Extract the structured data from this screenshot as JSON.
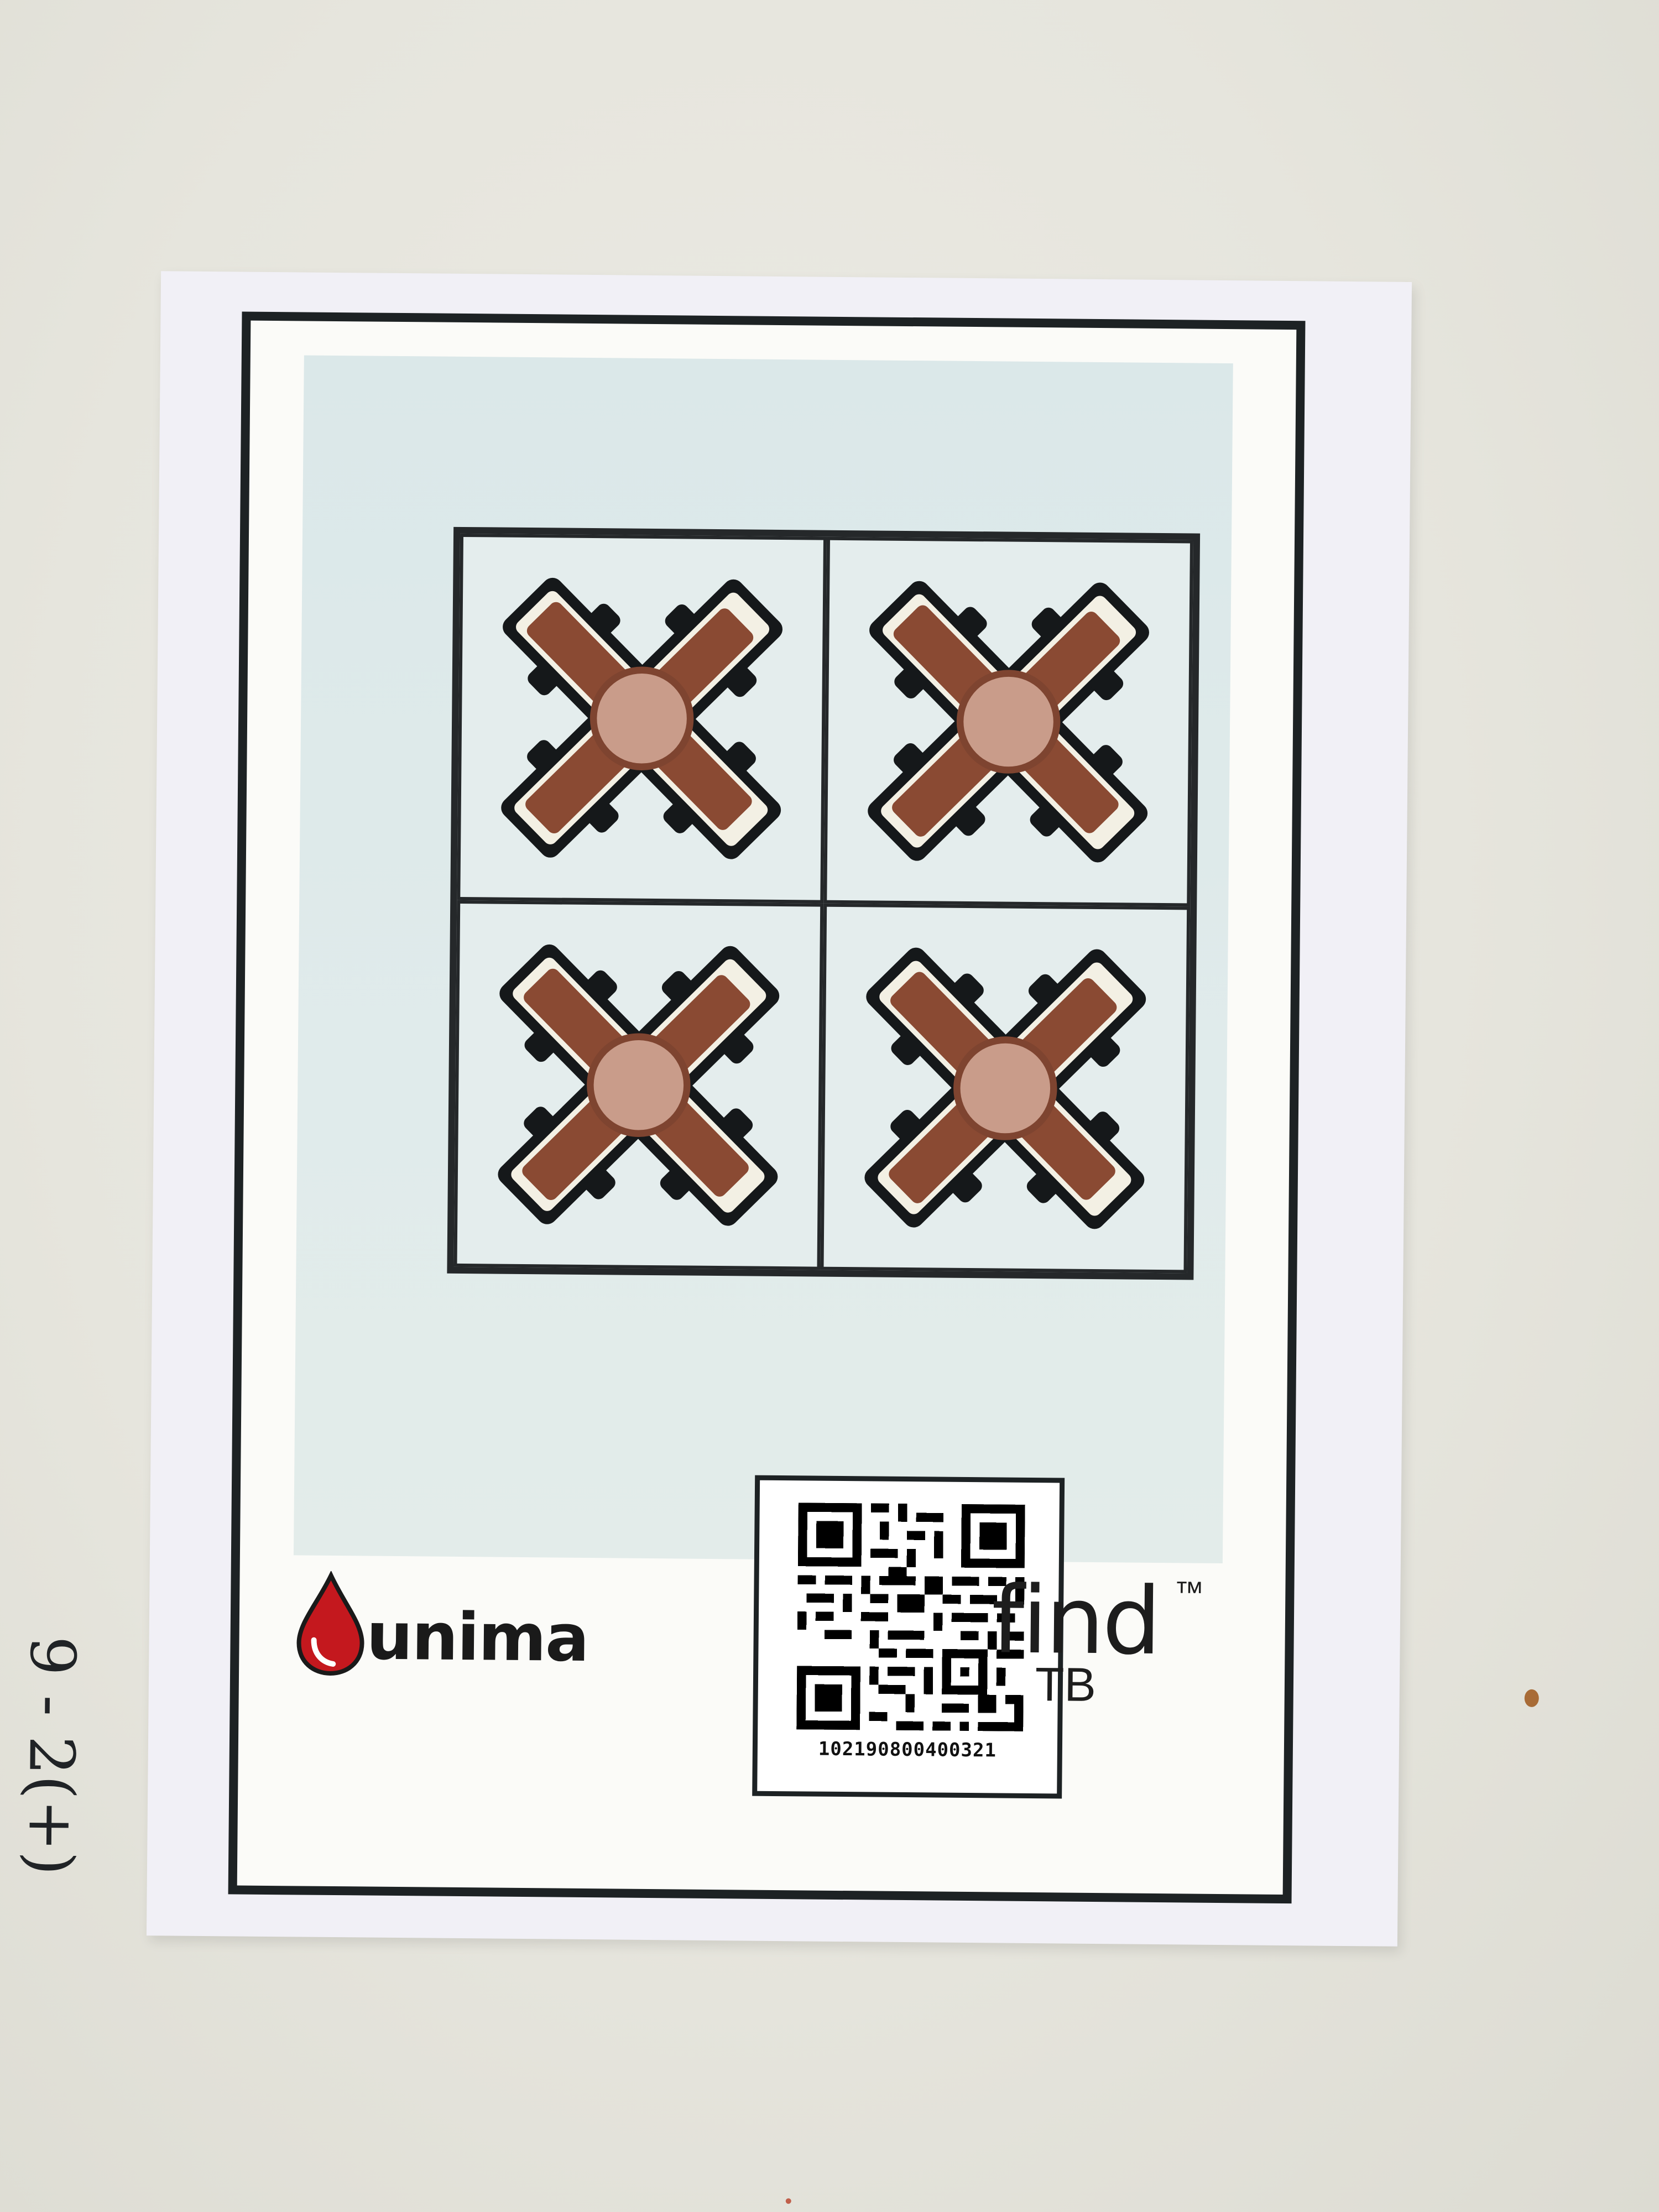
{
  "card": {
    "brand_left": "unima",
    "brand_right": "find",
    "brand_right_tm": "™",
    "brand_right_sub": "TB",
    "qr_number": "102190800400321",
    "handwritten_note": "9 - 2(+)"
  },
  "test_zones": [
    {
      "id": "top-left"
    },
    {
      "id": "top-right"
    },
    {
      "id": "bottom-left"
    },
    {
      "id": "bottom-right"
    }
  ],
  "colors": {
    "background": "#e6e5dd",
    "card": "#f1f0f6",
    "border": "#1d2224",
    "tint": "#dde9ea",
    "assay_arm": "#8a4a33",
    "assay_center": "#c99c8a",
    "drop_red": "#c4181e"
  }
}
